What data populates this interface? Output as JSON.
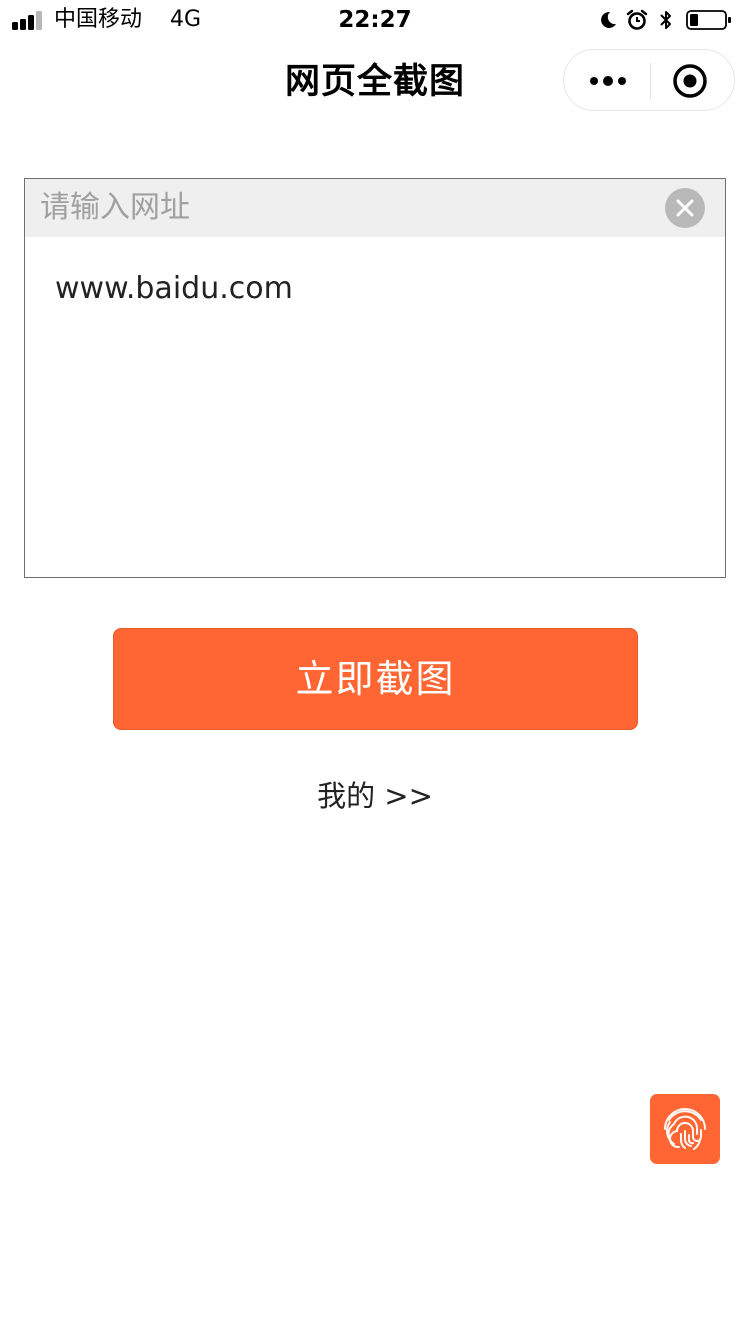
{
  "status_bar": {
    "carrier": "中国移动",
    "network": "4G",
    "time": "22:27",
    "icons": [
      "signal-icon",
      "moon-icon",
      "alarm-icon",
      "bluetooth-icon",
      "battery-icon"
    ]
  },
  "nav": {
    "title": "网页全截图",
    "icons": [
      "more-dots-icon",
      "close-target-icon"
    ]
  },
  "url_box": {
    "label": "请输入网址",
    "value": "www.baidu.com",
    "clear_icon": "clear-x-icon"
  },
  "capture_button": {
    "label": "立即截图"
  },
  "mine_link": {
    "label": "我的 >>"
  },
  "floating": {
    "icon": "fingerprint-icon"
  },
  "colors": {
    "accent": "#ff6633",
    "input_header_bg": "#efefef",
    "placeholder_text": "#a0a0a0",
    "text": "#222222"
  }
}
